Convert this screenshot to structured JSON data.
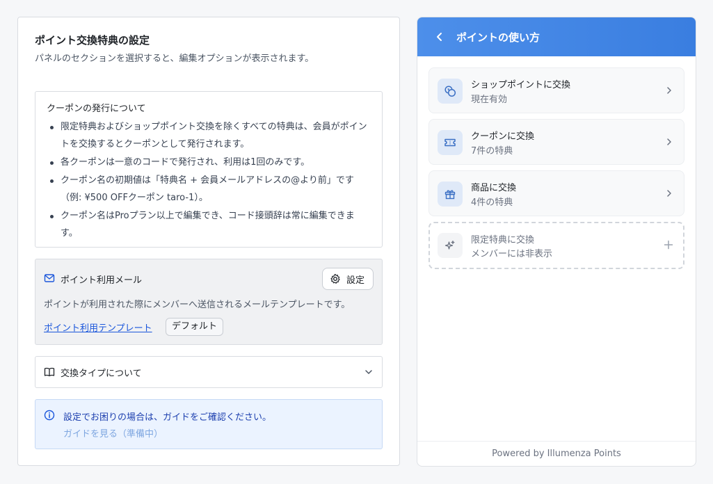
{
  "settings": {
    "title": "ポイント交換特典の設定",
    "subtitle": "パネルのセクションを選択すると、編集オプションが表示されます。",
    "coupon": {
      "title": "クーポンの発行について",
      "items": [
        "限定特典およびショップポイント交換を除くすべての特典は、会員がポイントを交換するとクーポンとして発行されます。",
        "各クーポンは一意のコードで発行され、利用は1回のみです。",
        "クーポン名の初期値は「特典名 + 会員メールアドレスの@より前」です（例: ¥500 OFFクーポン taro-1）。",
        "クーポン名はProプラン以上で編集でき、コード接頭辞は常に編集できます。"
      ]
    },
    "mail": {
      "title": "ポイント利用メール",
      "settings_label": "設定",
      "description": "ポイントが利用された際にメンバーへ送信されるメールテンプレートです。",
      "template_link": "ポイント利用テンプレート",
      "default_badge": "デフォルト"
    },
    "exchange_types": {
      "label": "交換タイプについて"
    },
    "info": {
      "text": "設定でお困りの場合は、ガイドをご確認ください。",
      "guide_link": "ガイドを見る（準備中）"
    }
  },
  "preview": {
    "title": "ポイントの使い方",
    "options": [
      {
        "title": "ショップポイントに交換",
        "subtitle": "現在有効",
        "icon": "coins-icon"
      },
      {
        "title": "クーポンに交換",
        "subtitle": "7件の特典",
        "icon": "ticket-icon"
      },
      {
        "title": "商品に交換",
        "subtitle": "4件の特典",
        "icon": "gift-icon"
      },
      {
        "title": "限定特典に交換",
        "subtitle": "メンバーには非表示",
        "icon": "sparkles-icon"
      }
    ],
    "footer": "Powered by Illumenza Points"
  },
  "colors": {
    "accent": "#4d8fea",
    "link": "#1a56db",
    "info_bg": "#ebf3ff"
  }
}
